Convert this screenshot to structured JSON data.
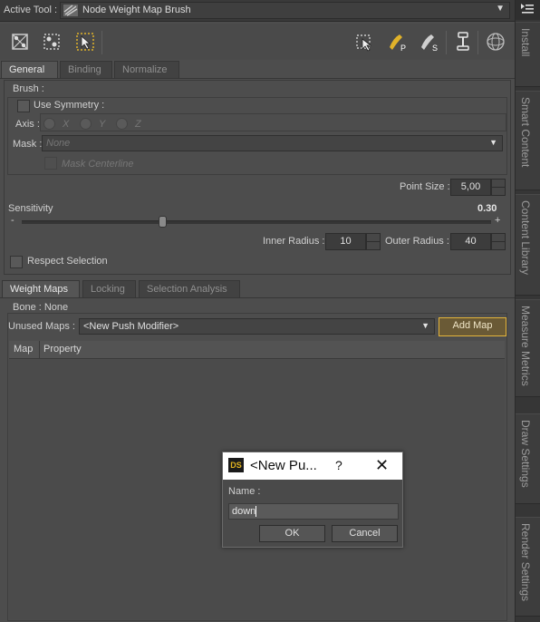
{
  "active_tool": {
    "label": "Active Tool :",
    "value": "Node Weight Map Brush"
  },
  "toolbar_icons": [
    "weight-map-tool-icon",
    "node-select-icon",
    "node-weight-brush-icon",
    "brush-settings-icon",
    "paint-brush-icon",
    "smooth-brush-icon",
    "pin-icon",
    "sphere-icon"
  ],
  "toolbar_letters": {
    "paint": "P",
    "smooth": "S"
  },
  "top_tabs": [
    {
      "label": "General",
      "active": true
    },
    {
      "label": "Binding",
      "active": false
    },
    {
      "label": "Normalize",
      "active": false
    }
  ],
  "brush": {
    "group_label": "Brush :",
    "use_symmetry": "Use Symmetry :",
    "axis_label": "Axis :",
    "axes": [
      "X",
      "Y",
      "Z"
    ],
    "mask_label": "Mask :",
    "mask_value": "None",
    "mask_centerline": "Mask Centerline"
  },
  "point_size": {
    "label": "Point Size :",
    "value": "5,00"
  },
  "sensitivity": {
    "label": "Sensitivity",
    "value": "0.30",
    "minus": "-",
    "plus": "+",
    "fraction": 0.3
  },
  "inner_radius": {
    "label": "Inner Radius :",
    "value": "10"
  },
  "outer_radius": {
    "label": "Outer Radius :",
    "value": "40"
  },
  "respect_selection": "Respect Selection",
  "lower_tabs": [
    {
      "label": "Weight Maps",
      "active": true
    },
    {
      "label": "Locking",
      "active": false
    },
    {
      "label": "Selection Analysis",
      "active": false
    }
  ],
  "bone": "Bone : None",
  "unused_maps": {
    "label": "Unused Maps :",
    "value": "<New Push Modifier>",
    "add_button": "Add Map"
  },
  "table": {
    "columns": [
      "Map",
      "Property"
    ]
  },
  "side_tabs": [
    "Install",
    "Smart Content",
    "Content Library",
    "Measure Metrics",
    "Draw Settings",
    "Render Settings"
  ],
  "dialog": {
    "logo": "DS",
    "title": "<New Pu...",
    "help": "?",
    "close": "✕",
    "name_label": "Name :",
    "name_value": "down",
    "ok": "OK",
    "cancel": "Cancel"
  },
  "colors": {
    "accent": "#e3b43b",
    "panel_bg": "#4d4d4d"
  }
}
